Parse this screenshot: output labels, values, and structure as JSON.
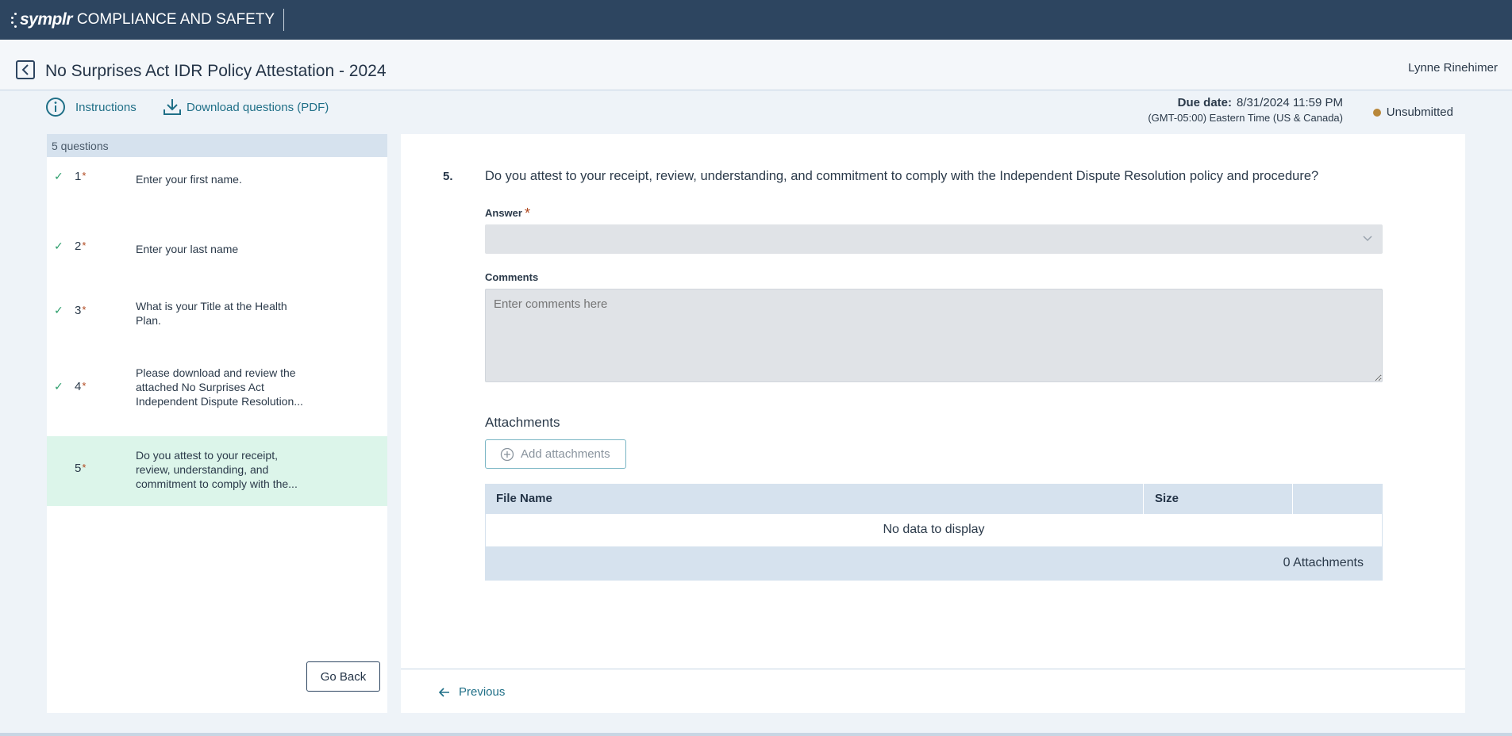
{
  "topbar": {
    "brand": "symplr",
    "product": "COMPLIANCE AND SAFETY"
  },
  "header": {
    "title": "No Surprises Act IDR Policy Attestation - 2024",
    "user": "Lynne Rinehimer"
  },
  "toolbar": {
    "instructions": "Instructions",
    "download": "Download questions (PDF)",
    "due_label": "Due date:",
    "due_value": "8/31/2024 11:59 PM",
    "due_tz": "(GMT-05:00) Eastern Time (US & Canada)",
    "status": "Unsubmitted",
    "status_color": "#b8873a"
  },
  "sidebar": {
    "count": "5 questions",
    "items": [
      {
        "num": "1",
        "star": "*",
        "text": "Enter your first name.",
        "done": true
      },
      {
        "num": "2",
        "star": "*",
        "text": "Enter your last name",
        "done": true
      },
      {
        "num": "3",
        "star": "*",
        "text": "What is your Title at the Health Plan.",
        "done": true
      },
      {
        "num": "4",
        "star": "*",
        "text": "Please download and review the attached No Surprises Act Independent Dispute Resolution...",
        "done": true
      },
      {
        "num": "5",
        "star": "*",
        "text": "Do you attest to your receipt, review, understanding, and commitment to comply with the...",
        "done": false,
        "active": true
      }
    ],
    "go_back": "Go Back"
  },
  "main": {
    "question_num": "5.",
    "question_text": "Do you attest to your receipt, review, understanding, and commitment to comply with the Independent Dispute Resolution policy and procedure?",
    "answer_label": "Answer",
    "answer_star": "*",
    "answer_value": "",
    "comments_label": "Comments",
    "comments_placeholder": "Enter comments here",
    "attachments_title": "Attachments",
    "add_attachments": "Add attachments",
    "table": {
      "columns": [
        "File Name",
        "Size",
        ""
      ],
      "empty": "No data to display",
      "footer": "0 Attachments"
    },
    "previous": "Previous"
  }
}
